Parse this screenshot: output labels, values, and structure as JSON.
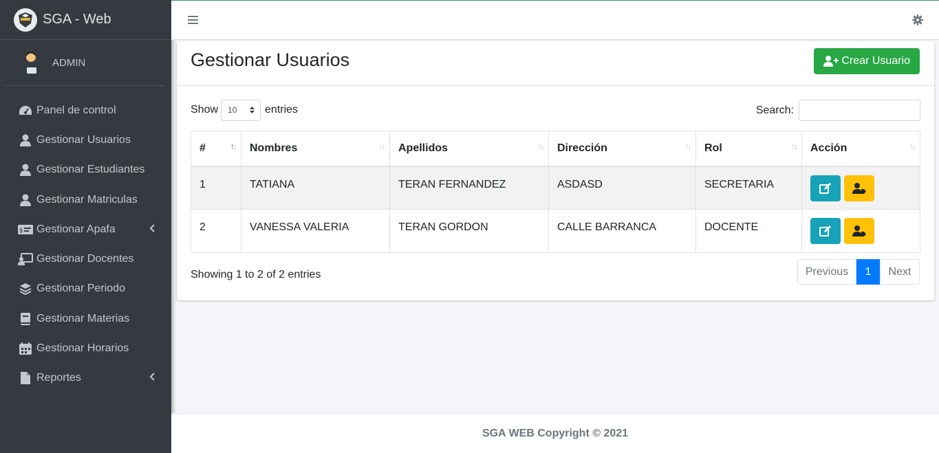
{
  "brand": {
    "title": "SGA - Web",
    "logo_icon": "school-crest-icon"
  },
  "user": {
    "name": "ADMIN",
    "avatar_icon": "admin-avatar-icon"
  },
  "sidebar": {
    "items": [
      {
        "label": "Panel de control",
        "icon": "tachometer-icon",
        "has_caret": false
      },
      {
        "label": "Gestionar Usuarios",
        "icon": "user-icon",
        "has_caret": false
      },
      {
        "label": "Gestionar Estudiantes",
        "icon": "user-icon",
        "has_caret": false
      },
      {
        "label": "Gestionar Matriculas",
        "icon": "user-icon",
        "has_caret": false
      },
      {
        "label": "Gestionar Apafa",
        "icon": "money-check-icon",
        "has_caret": true
      },
      {
        "label": "Gestionar Docentes",
        "icon": "chalkboard-teacher-icon",
        "has_caret": false
      },
      {
        "label": "Gestionar Periodo",
        "icon": "layer-group-icon",
        "has_caret": false
      },
      {
        "label": "Gestionar Materias",
        "icon": "book-icon",
        "has_caret": false
      },
      {
        "label": "Gestionar Horarios",
        "icon": "calendar-icon",
        "has_caret": false
      },
      {
        "label": "Reportes",
        "icon": "file-icon",
        "has_caret": true
      }
    ]
  },
  "card": {
    "title": "Gestionar Usuarios",
    "create_button": "Crear Usuario"
  },
  "controls": {
    "show_label": "Show",
    "page_size": "10",
    "entries_label": "entries",
    "search_label": "Search:",
    "search_value": ""
  },
  "table": {
    "headers": [
      "#",
      "Nombres",
      "Apellidos",
      "Dirección",
      "Rol",
      "Acción"
    ],
    "rows": [
      {
        "num": "1",
        "nombres": "TATIANA",
        "apellidos": "TERAN FERNANDEZ",
        "direccion": "ASDASD",
        "rol": "SECRETARIA"
      },
      {
        "num": "2",
        "nombres": "VANESSA VALERIA",
        "apellidos": "TERAN GORDON",
        "direccion": "CALLE BARRANCA",
        "rol": "DOCENTE"
      }
    ]
  },
  "footer_info": "Showing 1 to 2 of 2 entries",
  "pagination": {
    "previous": "Previous",
    "current": "1",
    "next": "Next"
  },
  "footer": "SGA WEB Copyright © 2021",
  "colors": {
    "sidebar_bg": "#343a40",
    "success": "#28a745",
    "info": "#17a2b8",
    "warning": "#ffc107",
    "primary": "#007bff"
  }
}
